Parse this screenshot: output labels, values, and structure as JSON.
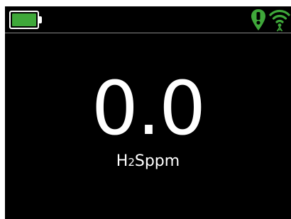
{
  "status": {
    "battery_level": 1.0,
    "battery_color": "#3fa83a",
    "alert_icon": "location-alert-icon",
    "alert_color": "#3fa83a",
    "wireless_icon": "wifi-icon",
    "wireless_color": "#3fa83a"
  },
  "reading": {
    "value": "0.0",
    "gas_prefix": "H",
    "gas_subscript": "2",
    "gas_suffix": "S",
    "unit": "ppm"
  }
}
